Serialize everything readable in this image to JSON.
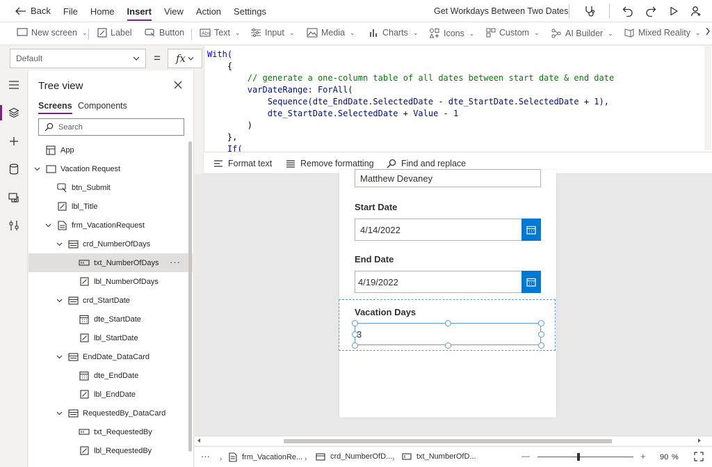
{
  "topbar": {
    "back_label": "Back",
    "menu": [
      "File",
      "Home",
      "Insert",
      "View",
      "Action",
      "Settings"
    ],
    "active_menu": "Insert",
    "app_title": "Get Workdays Between Two Dates"
  },
  "ribbon": {
    "items": [
      {
        "label": "New screen",
        "icon": "new-screen-icon",
        "dropdown": true
      },
      {
        "label": "Label",
        "icon": "label-icon",
        "dropdown": false
      },
      {
        "label": "Button",
        "icon": "button-icon",
        "dropdown": false
      },
      {
        "label": "Text",
        "icon": "text-icon",
        "dropdown": true
      },
      {
        "label": "Input",
        "icon": "input-icon",
        "dropdown": true
      },
      {
        "label": "Media",
        "icon": "media-icon",
        "dropdown": true
      },
      {
        "label": "Charts",
        "icon": "charts-icon",
        "dropdown": true
      },
      {
        "label": "Icons",
        "icon": "icons-icon",
        "dropdown": true
      },
      {
        "label": "Custom",
        "icon": "custom-icon",
        "dropdown": true
      },
      {
        "label": "AI Builder",
        "icon": "ai-builder-icon",
        "dropdown": true
      },
      {
        "label": "Mixed Reality",
        "icon": "mixed-reality-icon",
        "dropdown": true
      }
    ]
  },
  "formula_bar": {
    "property": "Default",
    "equals": "=",
    "fx": "fx"
  },
  "code": {
    "lines": [
      "With(",
      "    {",
      "        // generate a one-column table of all dates between start date & end date",
      "        varDateRange: ForAll(",
      "            Sequence(dte_EndDate.SelectedDate - dte_StartDate.SelectedDate + 1),",
      "            dte_StartDate.SelectedDate + Value - 1",
      "        )",
      "    },",
      "    If("
    ]
  },
  "formula_toolbar": {
    "format_text": "Format text",
    "remove_formatting": "Remove formatting",
    "find_replace": "Find and replace"
  },
  "tree": {
    "title": "Tree view",
    "tabs": [
      "Screens",
      "Components"
    ],
    "search_placeholder": "Search",
    "items": [
      {
        "label": "App",
        "icon": "app-icon",
        "indent": 0,
        "expander": "none"
      },
      {
        "label": "Vacation Request",
        "icon": "screen-icon",
        "indent": 0,
        "expander": "open"
      },
      {
        "label": "btn_Submit",
        "icon": "button-icon",
        "indent": 1,
        "expander": "none"
      },
      {
        "label": "lbl_Title",
        "icon": "label-icon",
        "indent": 1,
        "expander": "none"
      },
      {
        "label": "frm_VacationRequest",
        "icon": "form-icon",
        "indent": 1,
        "expander": "open"
      },
      {
        "label": "crd_NumberOfDays",
        "icon": "card-icon",
        "indent": 2,
        "expander": "open"
      },
      {
        "label": "txt_NumberOfDays",
        "icon": "textinput-icon",
        "indent": 3,
        "expander": "none",
        "selected": true
      },
      {
        "label": "lbl_NumberOfDays",
        "icon": "label-icon",
        "indent": 3,
        "expander": "none"
      },
      {
        "label": "crd_StartDate",
        "icon": "card-icon",
        "indent": 2,
        "expander": "open"
      },
      {
        "label": "dte_StartDate",
        "icon": "datepicker-icon",
        "indent": 3,
        "expander": "none"
      },
      {
        "label": "lbl_StartDate",
        "icon": "label-icon",
        "indent": 3,
        "expander": "none"
      },
      {
        "label": "EndDate_DataCard",
        "icon": "card-icon",
        "indent": 2,
        "expander": "open"
      },
      {
        "label": "dte_EndDate",
        "icon": "datepicker-icon",
        "indent": 3,
        "expander": "none"
      },
      {
        "label": "lbl_EndDate",
        "icon": "label-icon",
        "indent": 3,
        "expander": "none"
      },
      {
        "label": "RequestedBy_DataCard",
        "icon": "card-icon",
        "indent": 2,
        "expander": "open"
      },
      {
        "label": "txt_RequestedBy",
        "icon": "textinput-icon",
        "indent": 3,
        "expander": "none"
      },
      {
        "label": "lbl_RequestedBy",
        "icon": "label-icon",
        "indent": 3,
        "expander": "none"
      }
    ],
    "more": "···"
  },
  "canvas": {
    "requested_by_value": "Matthew Devaney",
    "start_date_label": "Start Date",
    "start_date_value": "4/14/2022",
    "end_date_label": "End Date",
    "end_date_value": "4/19/2022",
    "vacation_days_label": "Vacation Days",
    "vacation_days_value": "3"
  },
  "status_bar": {
    "more": "···",
    "crumbs": [
      "frm_VacationRe...",
      "crd_NumberOfD...",
      "txt_NumberOfD..."
    ],
    "zoom_minus": "—",
    "zoom_plus": "+",
    "zoom_value": "90",
    "zoom_unit": "%"
  },
  "colors": {
    "accent": "#742774",
    "date_button": "#0078d4",
    "selection": "#5d9bd5"
  }
}
